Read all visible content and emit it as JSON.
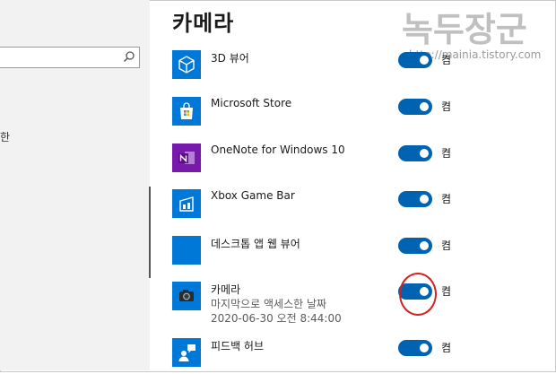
{
  "header": {
    "title": "카메라"
  },
  "watermark": {
    "text": "녹두장군",
    "url": "http://mainia.tistory.com"
  },
  "nav": {
    "stub_label": "한"
  },
  "colors": {
    "accent": "#0063b1",
    "tile": "#0078d7",
    "onenote": "#7719aa",
    "annotation": "#d42020"
  },
  "apps": [
    {
      "name": "3D 뷰어",
      "toggle": "켬",
      "icon": "cube-icon"
    },
    {
      "name": "Microsoft Store",
      "toggle": "켬",
      "icon": "store-bag-icon"
    },
    {
      "name": "OneNote for Windows 10",
      "toggle": "켬",
      "icon": "onenote-icon"
    },
    {
      "name": "Xbox Game Bar",
      "toggle": "켬",
      "icon": "game-bar-icon"
    },
    {
      "name": "데스크톱 앱 웹 뷰어",
      "toggle": "켬",
      "icon": "blank-tile-icon"
    },
    {
      "name": "카메라",
      "sub1": "마지막으로 액세스한 날짜",
      "sub2": "2020-06-30 오전 8:44:00",
      "toggle": "켬",
      "icon": "camera-icon"
    },
    {
      "name": "피드백 허브",
      "toggle": "켬",
      "icon": "feedback-icon"
    }
  ]
}
